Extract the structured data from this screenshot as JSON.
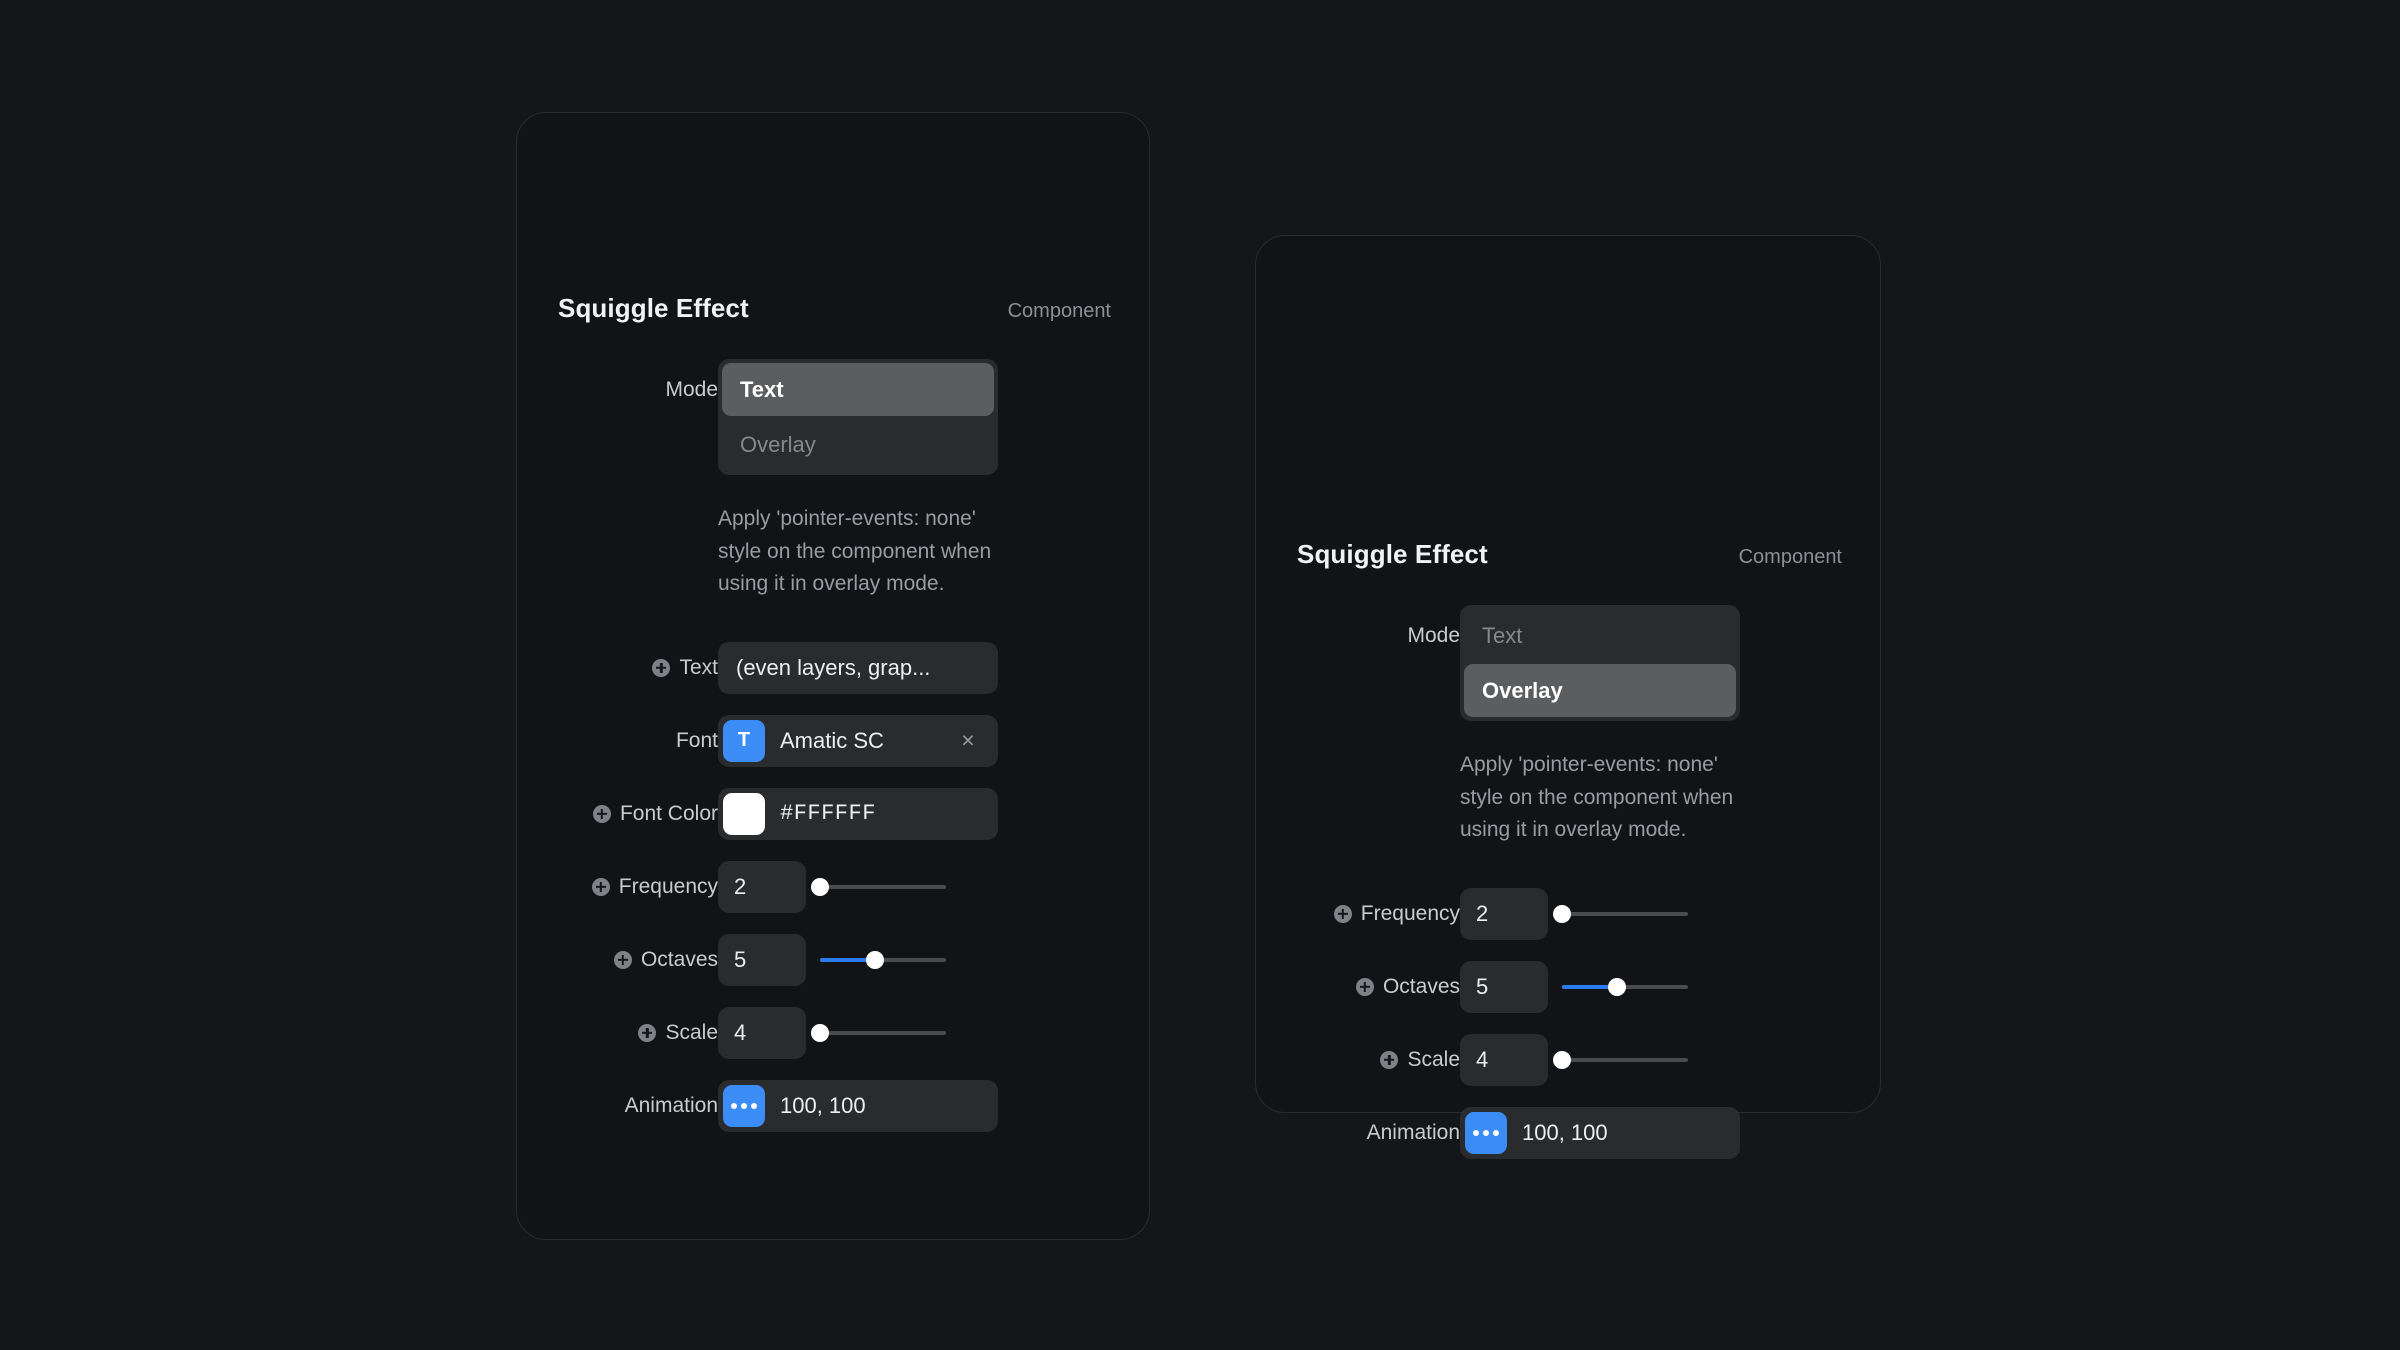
{
  "theme": {
    "page_bg": "#151619",
    "panel_bg": "#121316",
    "field_bg": "#2a2b2d",
    "accent": "#3b8cf4",
    "slider_fill": "#2a7df0",
    "selected_seg_bg": "#5c5d5f",
    "label_color": "#c9cbcf",
    "muted_color": "#8d8f94"
  },
  "panels": {
    "left": {
      "title": "Squiggle Effect",
      "kind": "Component",
      "mode": {
        "label": "Mode",
        "options": [
          "Text",
          "Overlay"
        ],
        "selected": "Text",
        "hint": "Apply 'pointer-events: none' style on the component when using it in overlay mode."
      },
      "fields": {
        "text": {
          "label": "Text",
          "value": "(even layers, grap..."
        },
        "font": {
          "label": "Font",
          "value": "Amatic SC",
          "chip": "T",
          "clear": "×"
        },
        "font_color": {
          "label": "Font Color",
          "value": "#FFFFFF",
          "swatch": "#FFFFFF"
        },
        "frequency": {
          "label": "Frequency",
          "value": "2",
          "slider_percent": 0
        },
        "octaves": {
          "label": "Octaves",
          "value": "5",
          "slider_percent": 44
        },
        "scale": {
          "label": "Scale",
          "value": "4",
          "slider_percent": 0
        },
        "animation": {
          "label": "Animation",
          "value": "100, 100"
        }
      }
    },
    "right": {
      "title": "Squiggle Effect",
      "kind": "Component",
      "mode": {
        "label": "Mode",
        "options": [
          "Text",
          "Overlay"
        ],
        "selected": "Overlay",
        "hint": "Apply 'pointer-events: none' style on the component when using it in overlay mode."
      },
      "fields": {
        "frequency": {
          "label": "Frequency",
          "value": "2",
          "slider_percent": 0
        },
        "octaves": {
          "label": "Octaves",
          "value": "5",
          "slider_percent": 44
        },
        "scale": {
          "label": "Scale",
          "value": "4",
          "slider_percent": 0
        },
        "animation": {
          "label": "Animation",
          "value": "100, 100"
        }
      }
    }
  }
}
